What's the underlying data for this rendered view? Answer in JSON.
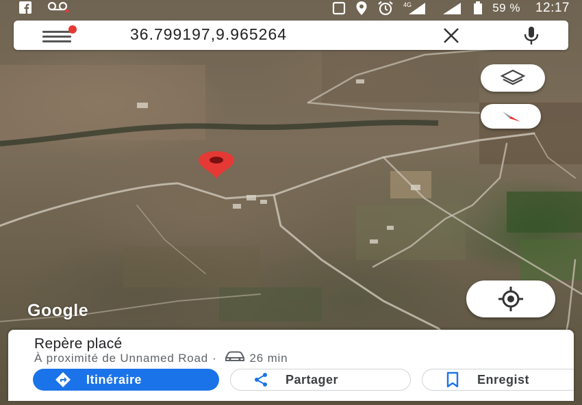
{
  "status_bar": {
    "battery_percent": "59 %",
    "time": "12:17",
    "network_label": "4G",
    "icons": [
      "facebook-icon",
      "voicemail-icon",
      "stop-icon",
      "location-icon",
      "alarm-icon",
      "signal-icon",
      "signal-icon-2",
      "battery-icon"
    ]
  },
  "search": {
    "value": "36.799197,9.965264",
    "menu_has_notification": true
  },
  "map": {
    "logo": "Google",
    "type": "satellite",
    "pin_color": "#e53935"
  },
  "place_sheet": {
    "title": "Repère placé",
    "near_text": "À proximité de Unnamed Road",
    "separator": "·",
    "travel_time": "26 min",
    "actions": {
      "directions_label": "Itinéraire",
      "share_label": "Partager",
      "save_label": "Enregist"
    }
  },
  "colors": {
    "accent": "#1a73e8",
    "pin": "#e53935",
    "compass_red": "#e53935"
  }
}
